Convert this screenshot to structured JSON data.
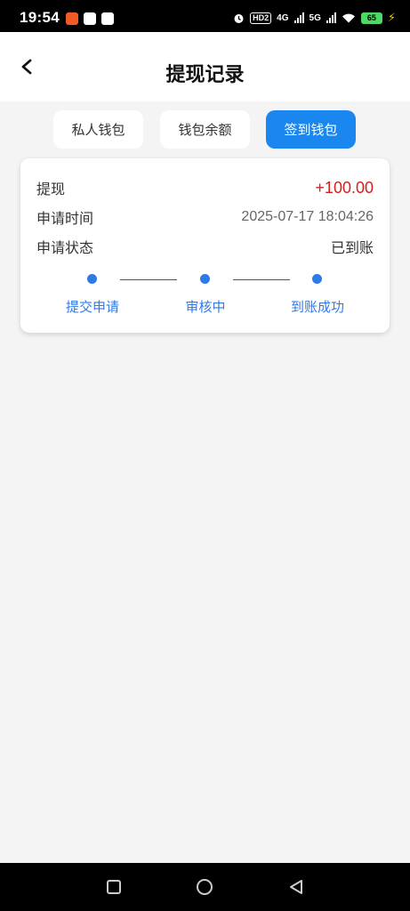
{
  "status_bar": {
    "time": "19:54",
    "hd_label": "HD2",
    "network_1": "4G",
    "network_2": "5G",
    "battery": "65"
  },
  "header": {
    "title": "提现记录"
  },
  "tabs": [
    {
      "label": "私人钱包",
      "active": false
    },
    {
      "label": "钱包余额",
      "active": false
    },
    {
      "label": "签到钱包",
      "active": true
    }
  ],
  "record": {
    "type_label": "提现",
    "amount": "+100.00",
    "time_label": "申请时间",
    "time_value": "2025-07-17 18:04:26",
    "status_label": "申请状态",
    "status_value": "已到账",
    "steps": [
      "提交申请",
      "审核中",
      "到账成功"
    ]
  },
  "colors": {
    "accent": "#1a86f0",
    "step_blue": "#2f7ae5",
    "amount_red": "#d81e1e",
    "page_bg": "#f4f4f4"
  }
}
